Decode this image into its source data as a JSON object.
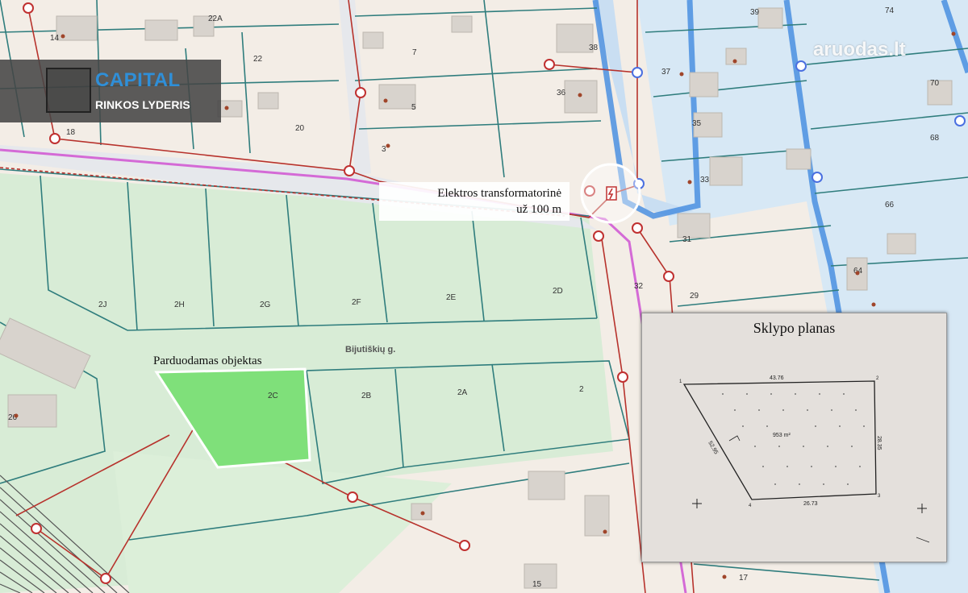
{
  "brand": {
    "name": "CAPITAL",
    "tagline": "RINKOS LYDERIS"
  },
  "watermark": "aruodas.lt",
  "annotations": {
    "transformer_line1": "Elektros transformatorinė",
    "transformer_line2": "už 100 m",
    "sale_object": "Parduodamas objektas",
    "street": "Bijutiškių g."
  },
  "parcel_labels": [
    "14",
    "22A",
    "22",
    "20",
    "18",
    "7",
    "5",
    "3",
    "36",
    "38",
    "37",
    "35",
    "33",
    "31",
    "39",
    "74",
    "70",
    "68",
    "66",
    "64",
    "2J",
    "2H",
    "2G",
    "2F",
    "2E",
    "2D",
    "2C",
    "2B",
    "2A",
    "2",
    "26",
    "29",
    "32",
    "15",
    "17"
  ],
  "plan": {
    "title": "Sklypo planas",
    "side_top": "43.76",
    "side_right": "28.35",
    "side_bottom": "26.73",
    "side_left": "52.95",
    "area": "953 m²",
    "corners": [
      "1",
      "2",
      "3",
      "4"
    ]
  },
  "colors": {
    "background": "#f3ede6",
    "green_area": "#d8ecd6",
    "highlight_parcel": "#7fe07a",
    "parcel_lines": "#2f7d7d",
    "water_blue": "#4a8fe0",
    "power_line": "#b7322c",
    "pink_line": "#d46ad6"
  }
}
